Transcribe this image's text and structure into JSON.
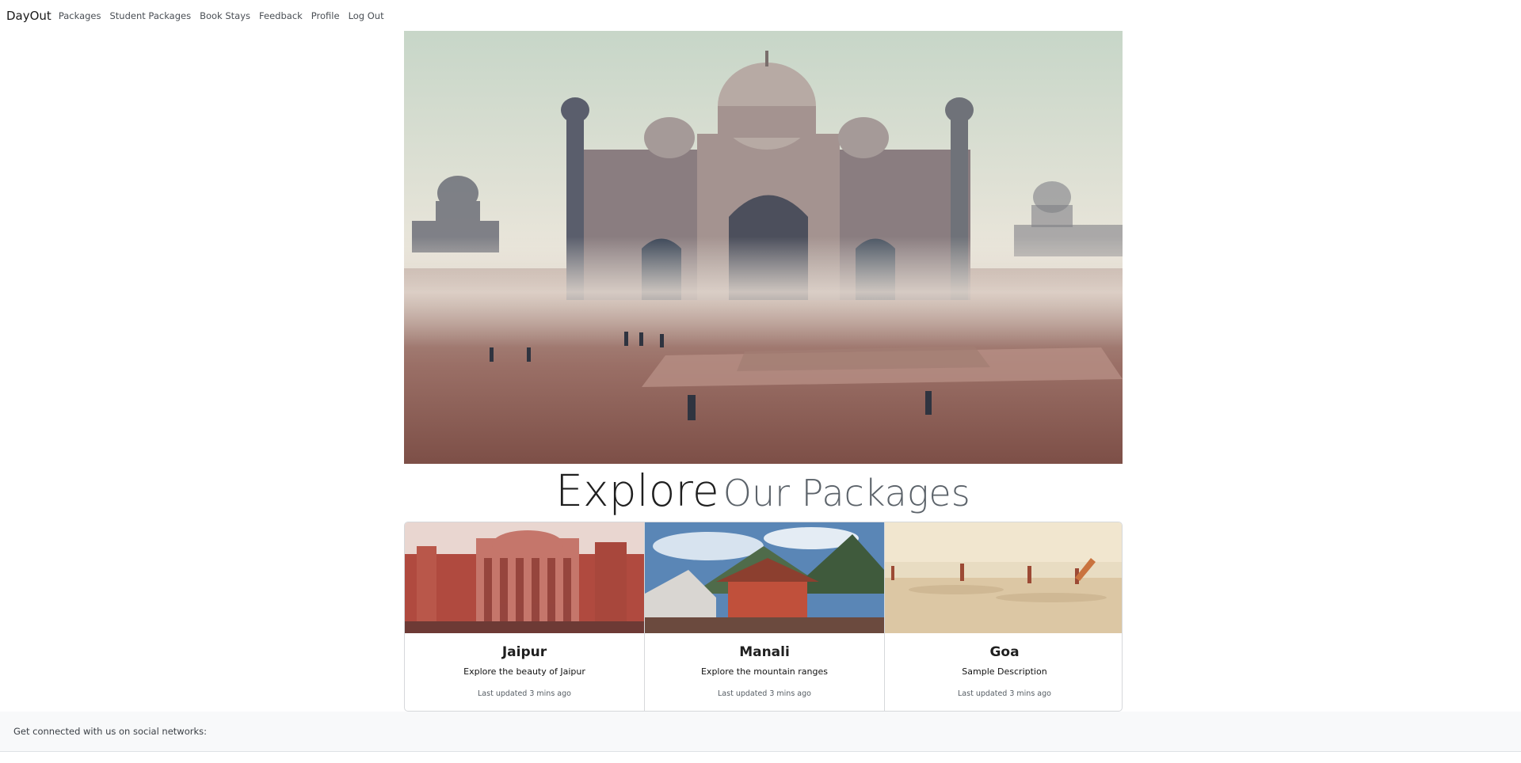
{
  "navbar": {
    "brand": "DayOut",
    "links": [
      "Packages",
      "Student Packages",
      "Book Stays",
      "Feedback",
      "Profile",
      "Log Out"
    ]
  },
  "hero": {
    "image": "taj-mahal-misty-photo"
  },
  "heading": {
    "strong": "Explore",
    "muted": "Our Packages"
  },
  "cards": [
    {
      "title": "Jaipur",
      "text": "Explore the beauty of Jaipur",
      "meta": "Last updated 3 mins ago",
      "image": "hawa-mahal-photo"
    },
    {
      "title": "Manali",
      "text": "Explore the mountain ranges",
      "meta": "Last updated 3 mins ago",
      "image": "mountain-temple-photo"
    },
    {
      "title": "Goa",
      "text": "Sample Description",
      "meta": "Last updated 3 mins ago",
      "image": "beach-surfers-photo"
    }
  ],
  "footer": {
    "text": "Get connected with us on social networks:"
  },
  "colors": {
    "footer_bg": "#f8f9fa",
    "border": "#d6d8db",
    "muted_heading": "#5c636a"
  }
}
